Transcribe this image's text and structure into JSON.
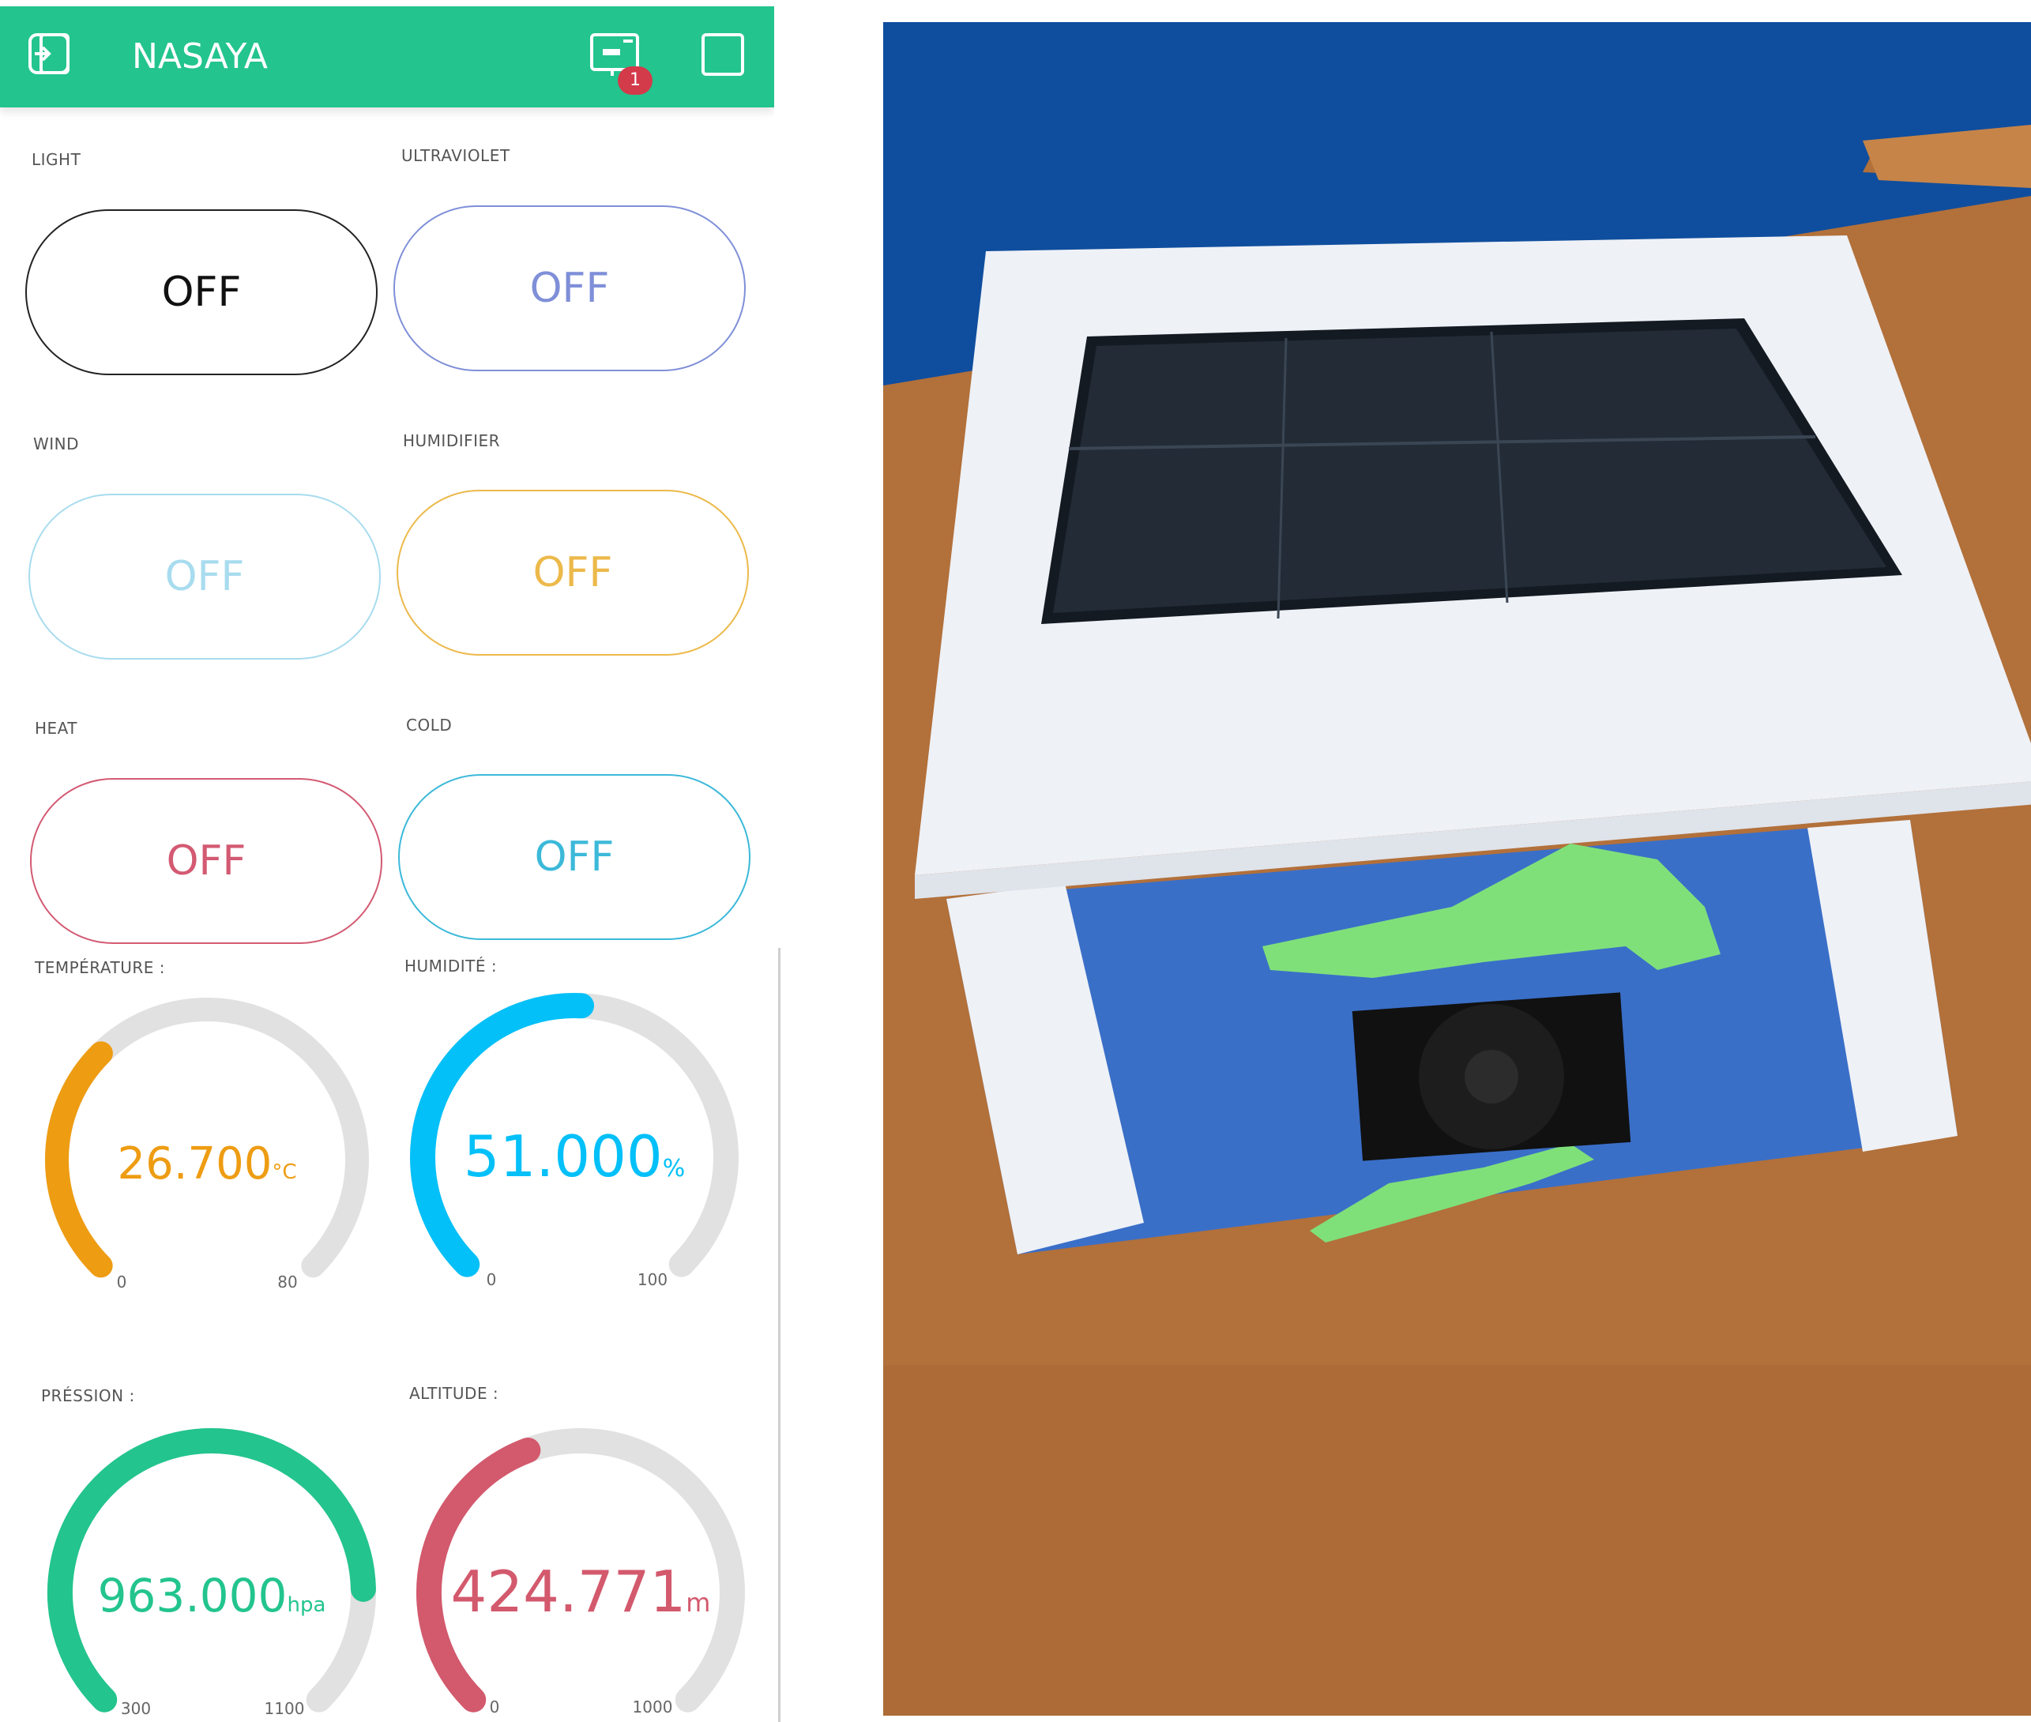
{
  "app": {
    "title": "NASAYA",
    "back_icon": "back-icon",
    "device_icon": "device-icon",
    "notification_badge": "1",
    "mode_icon": "square-icon",
    "accent_color": "#23c48e"
  },
  "buttons": [
    {
      "label": "LIGHT",
      "state": "OFF",
      "color": "#222222"
    },
    {
      "label": "ULTRAVIOLET",
      "state": "OFF",
      "color": "#7f8fd8"
    },
    {
      "label": "WIND",
      "state": "OFF",
      "color": "#a8dcef"
    },
    {
      "label": "HUMIDIFIER",
      "state": "OFF",
      "color": "#ecb94a"
    },
    {
      "label": "HEAT",
      "state": "OFF",
      "color": "#d35a72"
    },
    {
      "label": "COLD",
      "state": "OFF",
      "color": "#3cb9d9"
    }
  ],
  "gauges": [
    {
      "label": "TEMPÉRATURE :",
      "value": "26.700",
      "unit": "°C",
      "value_num": 26.7,
      "min": "0",
      "max": "80",
      "min_num": 0,
      "max_num": 80,
      "color": "#ee9c12"
    },
    {
      "label": "HUMIDITÉ :",
      "value": "51.000",
      "unit": "%",
      "value_num": 51,
      "min": "0",
      "max": "100",
      "min_num": 0,
      "max_num": 100,
      "color": "#04c0f8"
    },
    {
      "label": "PRÉSSION :",
      "value": "963.000",
      "unit": "hpa",
      "value_num": 963,
      "min": "300",
      "max": "1100",
      "min_num": 300,
      "max_num": 1100,
      "color": "#23c48e"
    },
    {
      "label": "ALTITUDE :",
      "value": "424.771",
      "unit": "m",
      "value_num": 424.771,
      "min": "0",
      "max": "1000",
      "min_num": 0,
      "max_num": 1000,
      "color": "#d3596d"
    }
  ],
  "photo": {
    "subject": "cardboard-weather-station-with-solar-panel",
    "wall_color": "#0f4e9e",
    "table_color": "#b2703a"
  }
}
